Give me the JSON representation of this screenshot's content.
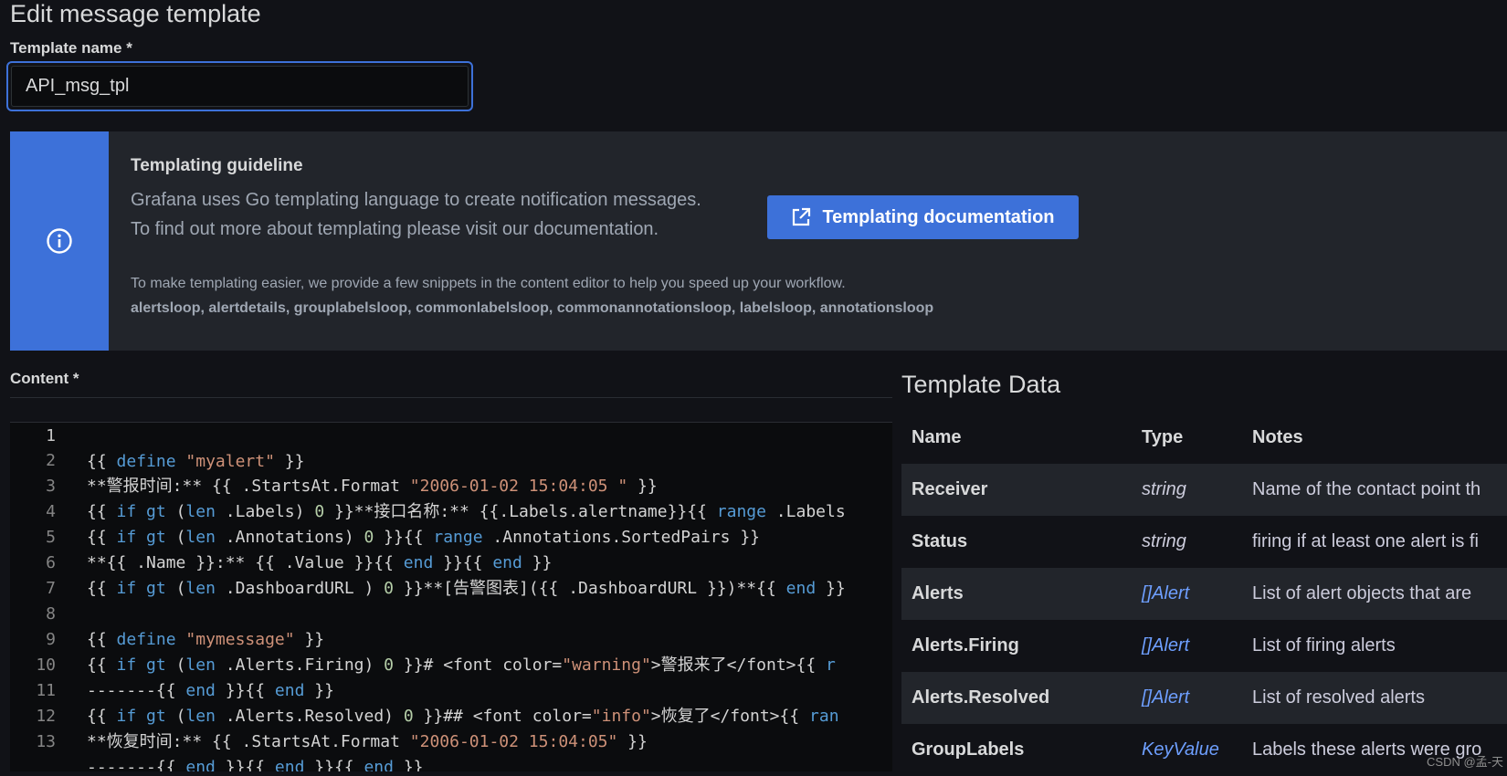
{
  "page": {
    "title": "Edit message template"
  },
  "template_name": {
    "label": "Template name *",
    "value": "API_msg_tpl"
  },
  "guideline": {
    "icon": "info-circle-icon",
    "title": "Templating guideline",
    "line1": "Grafana uses Go templating language to create notification messages.",
    "line2": "To find out more about templating please visit our documentation.",
    "button_icon": "external-link-icon",
    "button_label": "Templating documentation",
    "hint": "To make templating easier, we provide a few snippets in the content editor to help you speed up your workflow.",
    "snippets": "alertsloop, alertdetails, grouplabelsloop, commonlabelsloop, commonannotationsloop, labelsloop, annotationsloop"
  },
  "content": {
    "label": "Content *",
    "line_numbers": [
      "1",
      "2",
      "3",
      "4",
      "5",
      "6",
      "7",
      "8",
      "9",
      "10",
      "11",
      "12",
      "13"
    ]
  },
  "template_data": {
    "title": "Template Data",
    "headers": {
      "name": "Name",
      "type": "Type",
      "notes": "Notes"
    },
    "rows": [
      {
        "name": "Receiver",
        "type": "string",
        "notes": "Name of the contact point th"
      },
      {
        "name": "Status",
        "type": "string",
        "notes": "firing if at least one alert is fi"
      },
      {
        "name": "Alerts",
        "type": "[]Alert",
        "notes": "List of alert objects that are"
      },
      {
        "name": "Alerts.Firing",
        "type": "[]Alert",
        "notes": "List of firing alerts"
      },
      {
        "name": "Alerts.Resolved",
        "type": "[]Alert",
        "notes": "List of resolved alerts"
      },
      {
        "name": "GroupLabels",
        "type": "KeyValue",
        "notes": "Labels these alerts were gro"
      }
    ]
  },
  "watermark": "CSDN @孟-天",
  "colors": {
    "accent": "#3d71d9",
    "background": "#111217",
    "panel": "#22252b",
    "link": "#6e9fff"
  }
}
